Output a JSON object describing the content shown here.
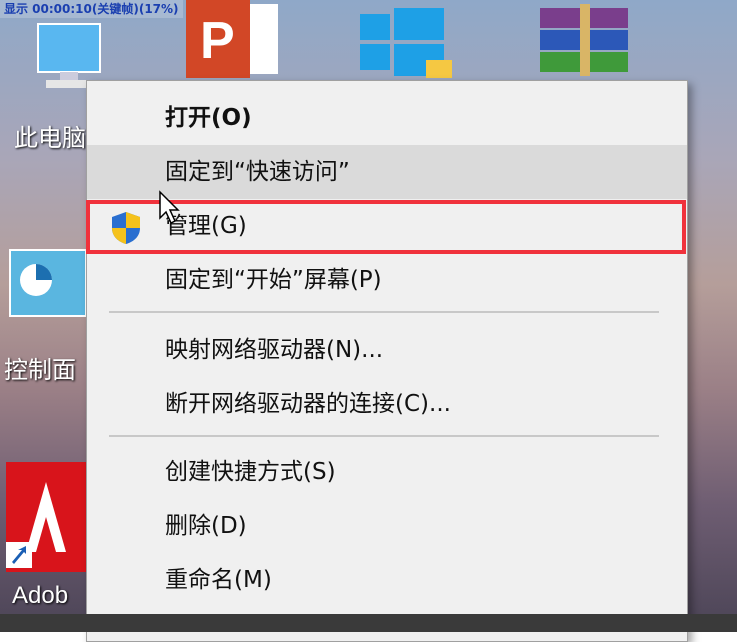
{
  "overlay": {
    "text": "显示 00:00:10(关键帧)(17%)"
  },
  "desktop_icons": [
    {
      "label": "此电脑",
      "icon": "this-pc-icon"
    },
    {
      "label": "",
      "icon": "powerpoint-icon"
    },
    {
      "label": "",
      "icon": "windows-store-icon"
    },
    {
      "label": "",
      "icon": "winrar-icon"
    },
    {
      "label": "控制面",
      "icon": "control-panel-icon"
    },
    {
      "label": "Adob",
      "icon": "adobe-icon"
    }
  ],
  "context_menu": {
    "items": [
      {
        "label": "打开(O)",
        "bold": true
      },
      {
        "label": "固定到“快速访问”"
      },
      {
        "label": "管理(G)",
        "icon": "uac-shield-icon"
      },
      {
        "label": "固定到“开始”屏幕(P)"
      },
      {
        "label": "映射网络驱动器(N)..."
      },
      {
        "label": "断开网络驱动器的连接(C)..."
      },
      {
        "label": "创建快捷方式(S)"
      },
      {
        "label": "删除(D)"
      },
      {
        "label": "重命名(M)"
      }
    ]
  },
  "colors": {
    "highlight": "#f0323c",
    "menu_bg": "#f0f0f0",
    "hover_bg": "#dadada"
  }
}
